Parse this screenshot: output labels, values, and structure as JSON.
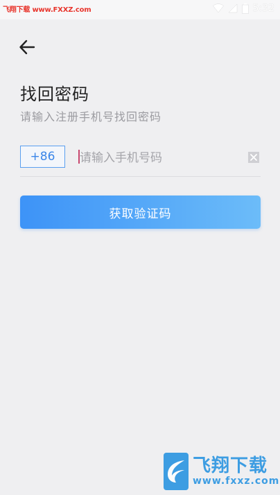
{
  "status_bar": {
    "watermark": "飞翔下载 www.FXXZ.com",
    "time": "5:32"
  },
  "header": {
    "back_icon": "arrow-left-icon"
  },
  "page": {
    "title": "找回密码",
    "subtitle": "请输入注册手机号找回密码"
  },
  "form": {
    "country_code": "+86",
    "phone_placeholder": "请输入手机号码",
    "phone_value": "",
    "clear_icon": "close-icon",
    "submit_label": "获取验证码"
  },
  "watermark_logo": {
    "name": "飞翔下载",
    "url": "www.fxxz.com"
  },
  "colors": {
    "accent": "#3d93f7",
    "accent_light": "#6cbcf9",
    "background": "#efeff1"
  }
}
